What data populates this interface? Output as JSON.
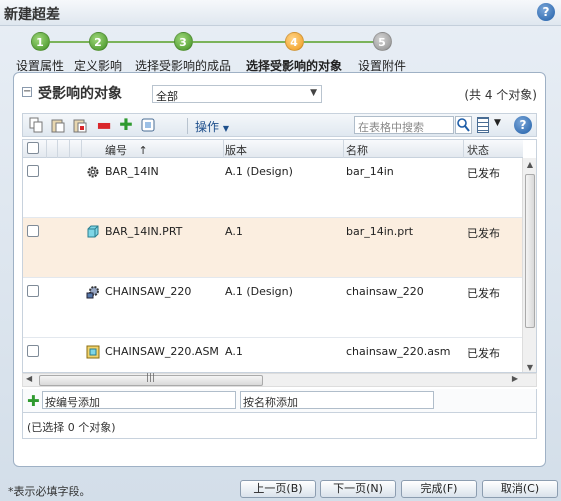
{
  "window": {
    "title": "新建超差"
  },
  "steps": [
    {
      "num": "1",
      "label": "设置属性",
      "state": "done"
    },
    {
      "num": "2",
      "label": "定义影响",
      "state": "done"
    },
    {
      "num": "3",
      "label": "选择受影响的成品",
      "state": "done"
    },
    {
      "num": "4",
      "label": "选择受影响的对象",
      "state": "active"
    },
    {
      "num": "5",
      "label": "设置附件",
      "state": "future"
    }
  ],
  "section": {
    "title": "受影响的对象",
    "filter_value": "全部",
    "count_text": "(共 4 个对象)"
  },
  "toolbar": {
    "actions_label": "操作",
    "search_placeholder": "在表格中搜索",
    "help_glyph": "?"
  },
  "table": {
    "columns": {
      "number": "编号",
      "sort_arrow": "↑",
      "version": "版本",
      "name": "名称",
      "status": "状态"
    },
    "rows": [
      {
        "number": "BAR_14IN",
        "version": "A.1 (Design)",
        "name": "bar_14in",
        "status": "已发布",
        "icon": "gear-icon"
      },
      {
        "number": "BAR_14IN.PRT",
        "version": "A.1",
        "name": "bar_14in.prt",
        "status": "已发布",
        "icon": "cad-part-icon"
      },
      {
        "number": "CHAINSAW_220",
        "version": "A.1 (Design)",
        "name": "chainsaw_220",
        "status": "已发布",
        "icon": "assembly-gear-icon"
      },
      {
        "number": "CHAINSAW_220.ASM",
        "version": "A.1",
        "name": "chainsaw_220.asm",
        "status": "已发布",
        "icon": "cad-assembly-icon"
      }
    ]
  },
  "add": {
    "by_number_placeholder": "按编号添加",
    "by_name_placeholder": "按名称添加"
  },
  "selection_info": "(已选择 0 个对象)",
  "footer": {
    "required_note": "*表示必填字段。",
    "prev": "上一页(B)",
    "next": "下一页(N)",
    "finish": "完成(F)",
    "cancel": "取消(C)"
  },
  "colors": {
    "accent": "#1f5ea8",
    "row_highlight": "#fbeee0",
    "step_done": "#3f8f22",
    "step_active": "#f09a1a"
  }
}
